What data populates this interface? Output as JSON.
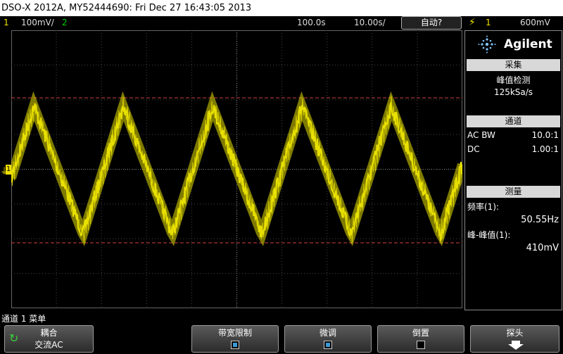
{
  "title": "DSO-X 2012A, MY52444690: Fri Dec 27 16:43:05 2013",
  "status": {
    "ch1_num": "1",
    "ch1_scale": "100mV/",
    "ch2_num": "2",
    "time_delay": "100.0s",
    "time_scale": "10.00s/",
    "trigger_mode": "自动?",
    "trigger_icon": "rising-edge-icon",
    "trigger_source": "1",
    "trigger_level": "600mV"
  },
  "screen": {
    "ground_marker": "1",
    "trace_color": "#e8e000",
    "cursor_color": "#d04040"
  },
  "panel": {
    "brand": "Agilent",
    "acq_header": "采集",
    "acq_mode": "峰值检测",
    "acq_rate": "125kSa/s",
    "ch_header": "通道",
    "ch1_coupling": "AC BW",
    "ch1_probe": "10.0:1",
    "ch2_coupling": "DC",
    "ch2_probe": "1.00:1",
    "meas_header": "测量",
    "meas1_label": "频率(1):",
    "meas1_value": "50.55Hz",
    "meas2_label": "峰-峰值(1):",
    "meas2_value": "410mV"
  },
  "softkeys": {
    "menu_title": "通道 1 菜单",
    "coupling_label": "耦合",
    "coupling_value": "交流AC",
    "bw_label": "带宽限制",
    "bw_checked": true,
    "fine_label": "微调",
    "fine_checked": true,
    "invert_label": "倒置",
    "invert_checked": false,
    "probe_label": "探头"
  }
}
